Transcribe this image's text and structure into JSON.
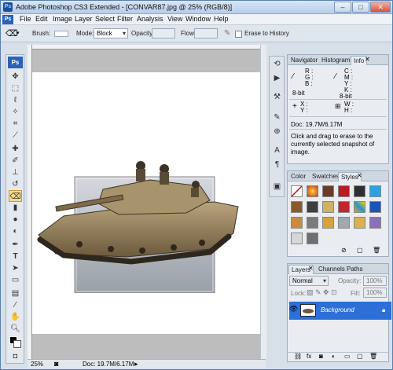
{
  "window": {
    "title": "Adobe Photoshop CS3 Extended - [CONVAR87.jpg @ 25% (RGB/8)]",
    "app_icon": "Ps"
  },
  "menu": [
    "File",
    "Edit",
    "Image",
    "Layer",
    "Select",
    "Filter",
    "Analysis",
    "View",
    "Window",
    "Help"
  ],
  "options": {
    "brush_label": "Brush:",
    "mode_label": "Mode:",
    "mode_value": "Block",
    "opacity_label": "Opacity:",
    "flow_label": "Flow:",
    "erase_history_label": "Erase to History"
  },
  "toolbox": {
    "logo": "Ps"
  },
  "status": {
    "zoom": "25%",
    "doc": "Doc: 19.7M/6.17M"
  },
  "info_panel": {
    "tabs": [
      "Navigator",
      "Histogram",
      "Info"
    ],
    "rgb": [
      "R :",
      "G :",
      "B :"
    ],
    "cmyk": [
      "C :",
      "M :",
      "Y :",
      "K :"
    ],
    "bit_left": "8-bit",
    "bit_right": "8-bit",
    "xy": [
      "X :",
      "Y :"
    ],
    "wh": [
      "W :",
      "H :"
    ],
    "doc": "Doc: 19.7M/6.17M",
    "hint": "Click and drag to erase to the currently selected snapshot of image."
  },
  "styles_panel": {
    "tabs": [
      "Color",
      "Swatches",
      "Styles"
    ]
  },
  "layers_panel": {
    "tabs": [
      "Layers",
      "Channels",
      "Paths"
    ],
    "blend_mode": "Normal",
    "opacity_label": "Opacity:",
    "opacity_value": "100%",
    "lock_label": "Lock:",
    "fill_label": "Fill:",
    "fill_value": "100%",
    "layer_name": "Background"
  },
  "colors": {
    "accent": "#2c6fd6",
    "chrome": "#d7dfe9"
  }
}
